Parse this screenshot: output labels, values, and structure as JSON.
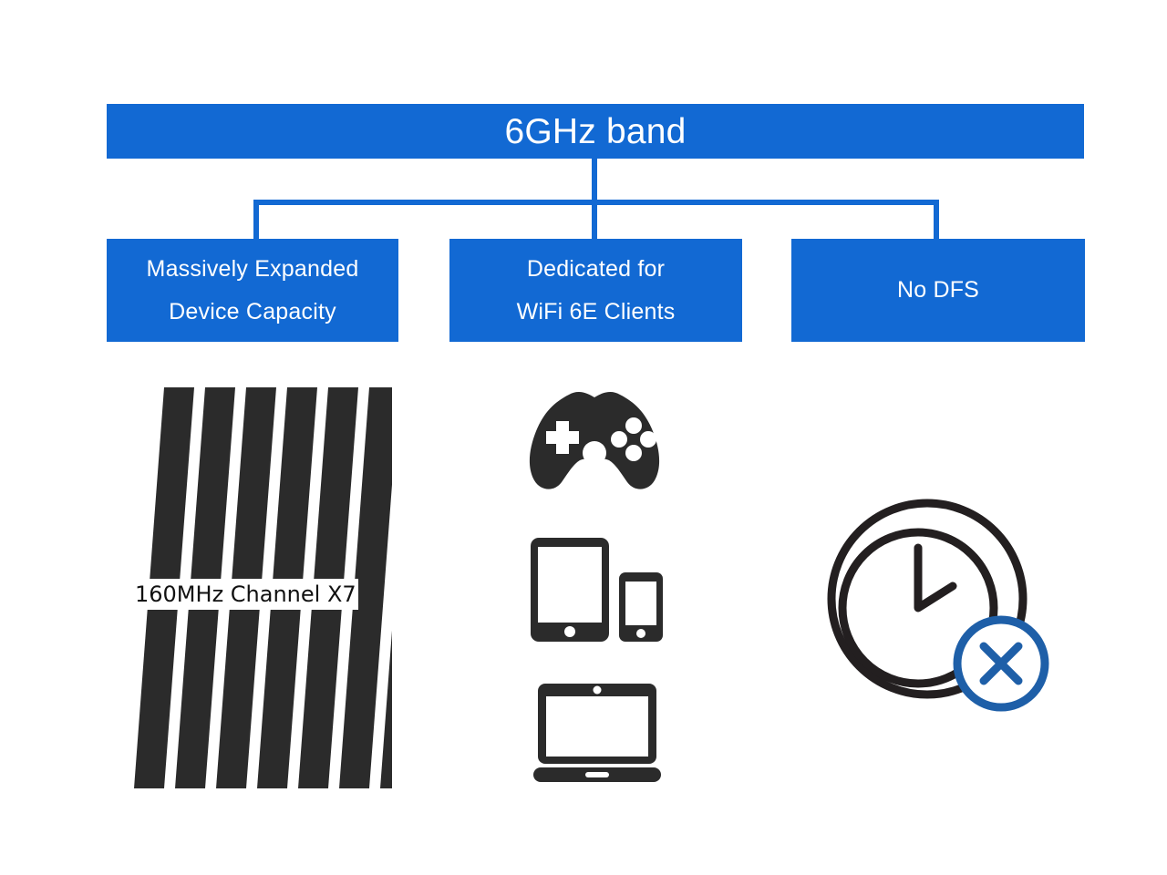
{
  "diagram": {
    "title": "6GHz band",
    "nodes": [
      {
        "id": "capacity",
        "line1": "Massively Expanded",
        "line2": "Device Capacity"
      },
      {
        "id": "dedicated",
        "line1": "Dedicated for",
        "line2": "WiFi 6E Clients"
      },
      {
        "id": "nodfs",
        "line1": "No DFS",
        "line2": ""
      }
    ]
  },
  "illustrations": {
    "channels": {
      "label": "160MHz Channel X7",
      "stripe_count": 7,
      "icon": "slanted-channel-bars-icon"
    },
    "clients": {
      "gamepad_icon": "gamepad-icon",
      "tablet_icon": "tablet-icon",
      "phone_icon": "phone-icon",
      "laptop_icon": "laptop-icon"
    },
    "dfs": {
      "clock_icon": "clock-icon",
      "x_icon": "circle-x-icon"
    }
  },
  "colors": {
    "brand_blue": "#1269d3",
    "x_blue": "#1e5fa8",
    "dark": "#2b2b2b",
    "background": "#ffffff"
  }
}
